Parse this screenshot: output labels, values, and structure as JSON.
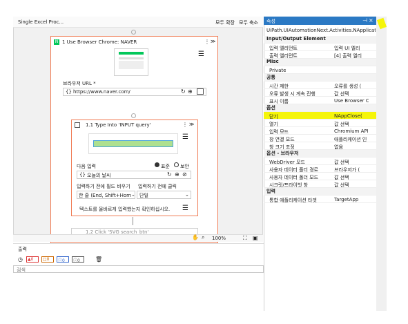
{
  "canvas": {
    "title": "Single Excel Proc...",
    "expand_all": "모두 확장",
    "collapse_all": "모두 축소",
    "zoom": "100%"
  },
  "browser_activity": {
    "title": "1 Use Browser Chrome: NAVER",
    "url_label": "브라우저 URL *",
    "url_value": "https://www.naver.com/"
  },
  "type_activity": {
    "title": "1.1 Type Into 'INPUT query'",
    "input_label": "다음 입력",
    "radio_standard": "표준",
    "radio_secure": "보안",
    "input_value": "오늘의 날씨",
    "clear_label": "입력하기 전에 필드 비우기",
    "click_label": "입력하기 전에 클릭",
    "clear_value": "한 줄 (End, Shift+Home",
    "click_value": "단일",
    "verify_text": "텍스트를 올바르게 입력했는지 확인하십시오."
  },
  "next_activity": {
    "title": "1.2 Click 'SVG search_btn'"
  },
  "output": {
    "title": "출력",
    "counts": [
      "0",
      "0",
      "0",
      "0"
    ],
    "search_placeholder": "검색"
  },
  "properties": {
    "title": "속성",
    "type_name": "UiPath.UIAutomationNext.Activities.NApplicationCa...",
    "sections": [
      {
        "name": "Input/Output Element",
        "rows": [
          {
            "label": "입력 엘리먼트",
            "value": "입력 UI 엘리"
          },
          {
            "label": "출력 엘리먼트",
            "value": "[4] 출력 엘리"
          }
        ]
      },
      {
        "name": "Misc",
        "rows": [
          {
            "label": "Private",
            "value": ""
          }
        ]
      },
      {
        "name": "공통",
        "rows": [
          {
            "label": "시간 제한",
            "value": "오류를 생성 ("
          },
          {
            "label": "오류 발생 시 계속 진행",
            "value": "값 선택"
          },
          {
            "label": "표시 이름",
            "value": "Use Browser Chrom"
          }
        ]
      },
      {
        "name": "옵션",
        "rows": [
          {
            "label": "닫기",
            "value": "NAppClose("
          },
          {
            "label": "열기",
            "value": "값 선택"
          },
          {
            "label": "입력 모드",
            "value": "Chromium API"
          },
          {
            "label": "창 연결 모드",
            "value": "애플리케이션 인"
          },
          {
            "label": "창 크기 조정",
            "value": "없음"
          }
        ]
      },
      {
        "name": "옵션 - 브라우저",
        "rows": [
          {
            "label": "WebDriver 모드",
            "value": "값 선택"
          },
          {
            "label": "사용자 데이터 폴더 경로",
            "value": "브라우저가 ("
          },
          {
            "label": "사용자 데이터 폴더 모드",
            "value": "값 선택"
          },
          {
            "label": "시크릿/프라이빗 창",
            "value": "값 선택"
          }
        ]
      },
      {
        "name": "입력",
        "rows": [
          {
            "label": "통합 애플리케이션 타겟",
            "value": "TargetApp"
          }
        ]
      }
    ]
  },
  "colors": {
    "highlight": "#f5f50a",
    "accent": "#f07a52",
    "brand": "#03c75a"
  }
}
